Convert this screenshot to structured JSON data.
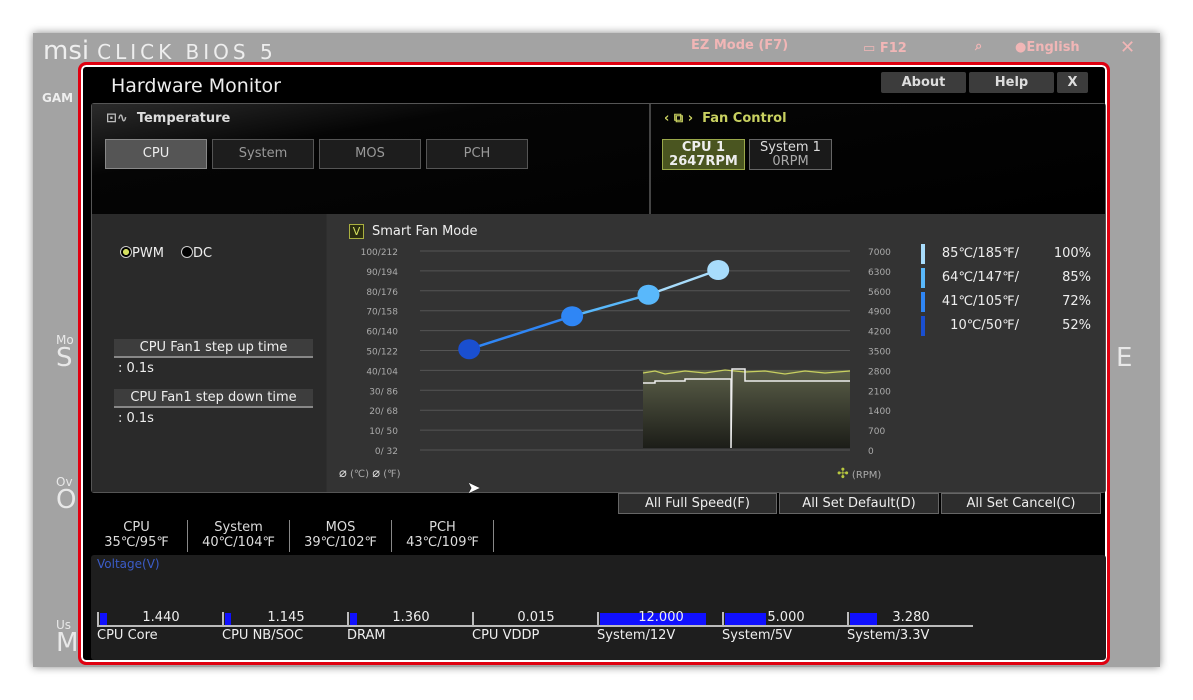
{
  "bios": {
    "brand": "msi",
    "product": "CLICK BIOS 5",
    "ez_mode": "EZ Mode (F7)",
    "f12": "F12",
    "language": "English",
    "side_label": "GAM",
    "bg_left": [
      "Mo",
      "S",
      "Ov",
      "O",
      "Us",
      "M"
    ],
    "bg_right": "E"
  },
  "window": {
    "title": "Hardware Monitor",
    "about": "About",
    "help": "Help",
    "close": "X"
  },
  "temperature": {
    "label": "Temperature",
    "tabs": [
      "CPU",
      "System",
      "MOS",
      "PCH"
    ],
    "active_tab": "CPU"
  },
  "fan_control": {
    "label": "Fan Control",
    "fans": [
      {
        "name": "CPU 1",
        "rpm": "2647RPM",
        "active": true
      },
      {
        "name": "System 1",
        "rpm": "0RPM",
        "active": false
      }
    ]
  },
  "mode": {
    "pwm": "PWM",
    "dc": "DC",
    "selected": "PWM"
  },
  "step_up": {
    "label": "CPU Fan1 step up time",
    "value": ": 0.1s"
  },
  "step_down": {
    "label": "CPU Fan1 step down time",
    "value": ": 0.1s"
  },
  "smart_fan": {
    "label": "Smart Fan Mode",
    "checked": true,
    "check_glyph": "V"
  },
  "chart_data": {
    "type": "line",
    "left_ticks": [
      "100/212",
      "90/194",
      "80/176",
      "70/158",
      "60/140",
      "50/122",
      "40/104",
      "30/  86",
      "20/  68",
      "10/  50",
      "0/  32"
    ],
    "right_ticks": [
      "7000",
      "6300",
      "5600",
      "4900",
      "4200",
      "3500",
      "2800",
      "2100",
      "1400",
      "700",
      "0"
    ],
    "left_unit_c": "(℃)",
    "left_unit_f": "(℉)",
    "right_unit": "(RPM)",
    "fan_curve": [
      {
        "temp_c": 10,
        "percent": 52,
        "color": "#1a4fd0"
      },
      {
        "temp_c": 41,
        "percent": 72,
        "color": "#2f86f5"
      },
      {
        "temp_c": 64,
        "percent": 85,
        "color": "#59b8fb"
      },
      {
        "temp_c": 85,
        "percent": 100,
        "color": "#a8dcfb"
      }
    ],
    "legend": [
      {
        "temp": "85℃/185℉/",
        "pct": "100%",
        "color": "#a8dcfb"
      },
      {
        "temp": "64℃/147℉/",
        "pct": "85%",
        "color": "#59b8fb"
      },
      {
        "temp": "41℃/105℉/",
        "pct": "72%",
        "color": "#2f86f5"
      },
      {
        "temp": "10℃/50℉/",
        "pct": "52%",
        "color": "#1a4fd0"
      }
    ]
  },
  "actions": {
    "full_speed": "All Full Speed(F)",
    "set_default": "All Set Default(D)",
    "set_cancel": "All Set Cancel(C)"
  },
  "temps": [
    {
      "name": "CPU",
      "value": "35℃/95℉"
    },
    {
      "name": "System",
      "value": "40℃/104℉"
    },
    {
      "name": "MOS",
      "value": "39℃/102℉"
    },
    {
      "name": "PCH",
      "value": "43℃/109℉"
    }
  ],
  "voltage": {
    "label": "Voltage(V)",
    "items": [
      {
        "name": "CPU Core",
        "value": "1.440",
        "fill": 0.06
      },
      {
        "name": "CPU NB/SOC",
        "value": "1.145",
        "fill": 0.05
      },
      {
        "name": "DRAM",
        "value": "1.360",
        "fill": 0.06
      },
      {
        "name": "CPU VDDP",
        "value": "0.015",
        "fill": 0
      },
      {
        "name": "System/12V",
        "value": "12.000",
        "fill": 0.87
      },
      {
        "name": "System/5V",
        "value": "5.000",
        "fill": 0.34
      },
      {
        "name": "System/3.3V",
        "value": "3.280",
        "fill": 0.22
      }
    ]
  }
}
